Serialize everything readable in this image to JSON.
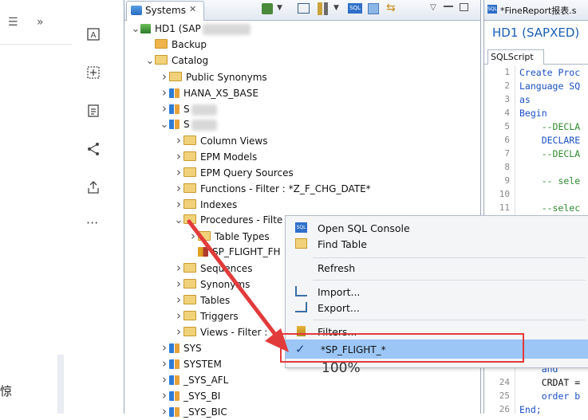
{
  "left": {
    "bottom_char": "惊"
  },
  "systems": {
    "tab_label": "Systems",
    "tree": [
      {
        "label": "HD1 (SAP",
        "indent": 0,
        "chev": "v",
        "icon": "system"
      },
      {
        "label": "Backup",
        "indent": 1,
        "chev": "",
        "icon": "backup"
      },
      {
        "label": "Catalog",
        "indent": 1,
        "chev": "v",
        "icon": "folder"
      },
      {
        "label": "Public Synonyms",
        "indent": 2,
        "chev": ">",
        "icon": "folder"
      },
      {
        "label": "HANA_XS_BASE",
        "indent": 2,
        "chev": ">",
        "icon": "schema"
      },
      {
        "label": "S",
        "indent": 2,
        "chev": ">",
        "icon": "schema",
        "blur": true
      },
      {
        "label": "S",
        "indent": 2,
        "chev": "v",
        "icon": "schema",
        "blur": true
      },
      {
        "label": "Column Views",
        "indent": 3,
        "chev": ">",
        "icon": "folder"
      },
      {
        "label": "EPM Models",
        "indent": 3,
        "chev": ">",
        "icon": "folder"
      },
      {
        "label": "EPM Query Sources",
        "indent": 3,
        "chev": ">",
        "icon": "folder"
      },
      {
        "label": "Functions - Filter : *Z_F_CHG_DATE*",
        "indent": 3,
        "chev": ">",
        "icon": "folder"
      },
      {
        "label": "Indexes",
        "indent": 3,
        "chev": ">",
        "icon": "folder"
      },
      {
        "label": "Procedures - Filte",
        "indent": 3,
        "chev": "v",
        "icon": "folder"
      },
      {
        "label": "Table Types",
        "indent": 4,
        "chev": ">",
        "icon": "folder"
      },
      {
        "label": "SP_FLIGHT_FH",
        "indent": 4,
        "chev": "",
        "icon": "proc"
      },
      {
        "label": "Sequences",
        "indent": 3,
        "chev": ">",
        "icon": "folder"
      },
      {
        "label": "Synonyms",
        "indent": 3,
        "chev": ">",
        "icon": "folder"
      },
      {
        "label": "Tables",
        "indent": 3,
        "chev": ">",
        "icon": "folder"
      },
      {
        "label": "Triggers",
        "indent": 3,
        "chev": ">",
        "icon": "folder"
      },
      {
        "label": "Views - Filter :",
        "indent": 3,
        "chev": ">",
        "icon": "folder"
      },
      {
        "label": "SYS",
        "indent": 2,
        "chev": ">",
        "icon": "schema"
      },
      {
        "label": "SYSTEM",
        "indent": 2,
        "chev": ">",
        "icon": "schema"
      },
      {
        "label": "_SYS_AFL",
        "indent": 2,
        "chev": ">",
        "icon": "schema"
      },
      {
        "label": "_SYS_BI",
        "indent": 2,
        "chev": ">",
        "icon": "schema"
      },
      {
        "label": "_SYS_BIC",
        "indent": 2,
        "chev": ">",
        "icon": "schema"
      }
    ]
  },
  "editor": {
    "tab_label": "*FineReport报表.s",
    "title": "HD1 (SAPXED)",
    "sql_tab": "SQLScript",
    "lines": [
      {
        "n": "1",
        "t": "Create Proc",
        "c": "#1a4fc4"
      },
      {
        "n": "2",
        "t": "Language SQ",
        "c": "#1a4fc4"
      },
      {
        "n": "3",
        "t": "as",
        "c": "#1a4fc4"
      },
      {
        "n": "4",
        "t": "Begin",
        "c": "#1a4fc4"
      },
      {
        "n": "5",
        "t": "    --DECLA",
        "c": "#2e8b2e"
      },
      {
        "n": "6",
        "t": "    DECLARE",
        "c": "#1a4fc4"
      },
      {
        "n": "7",
        "t": "    --DECLA",
        "c": "#2e8b2e"
      },
      {
        "n": "8",
        "t": "",
        "c": "#111"
      },
      {
        "n": "9",
        "t": "    -- sele",
        "c": "#2e8b2e"
      },
      {
        "n": "10",
        "t": "",
        "c": "#111"
      },
      {
        "n": "11",
        "t": "    --selec",
        "c": "#2e8b2e"
      }
    ],
    "bottom_lines": [
      {
        "n": "",
        "t": "    and",
        "c": "#1a4fc4"
      },
      {
        "n": "24",
        "t": "    CRDAT =",
        "c": "#111"
      },
      {
        "n": "25",
        "t": "    order b",
        "c": "#1a4fc4"
      },
      {
        "n": "26",
        "t": "End;",
        "c": "#1a4fc4"
      }
    ]
  },
  "menu": {
    "items": [
      {
        "label": "Open SQL Console",
        "icon": "sql-console-icon"
      },
      {
        "label": "Find Table",
        "icon": "find-table-icon"
      },
      {
        "label": "Refresh",
        "icon": ""
      },
      {
        "label": "Import...",
        "icon": "import-icon"
      },
      {
        "label": "Export...",
        "icon": "export-icon"
      },
      {
        "label": "Filters...",
        "icon": "filter-icon"
      },
      {
        "label": "*SP_FLIGHT_*",
        "icon": "check-icon"
      }
    ]
  },
  "overlay": {
    "percent": "100%",
    "highlight_color": "#e23b3b"
  }
}
